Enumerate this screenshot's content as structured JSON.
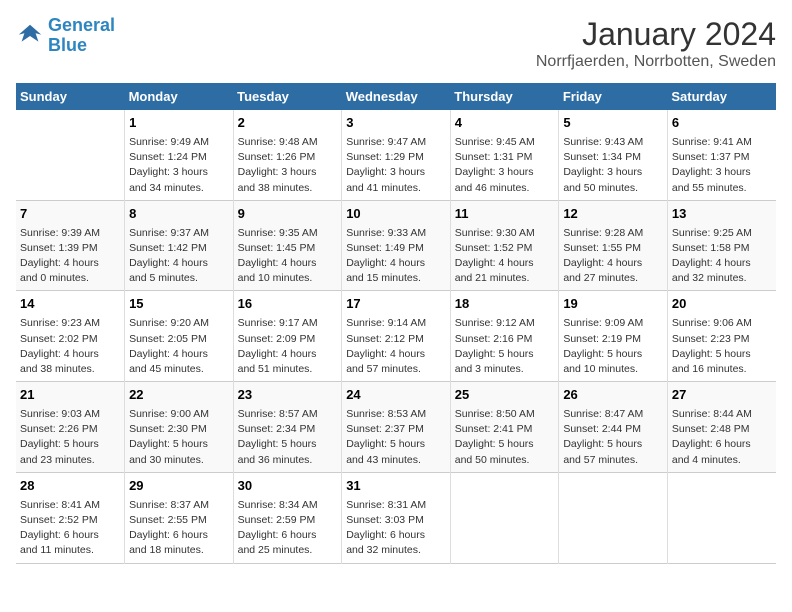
{
  "header": {
    "logo_general": "General",
    "logo_blue": "Blue",
    "title": "January 2024",
    "subtitle": "Norrfjaerden, Norrbotten, Sweden"
  },
  "weekdays": [
    "Sunday",
    "Monday",
    "Tuesday",
    "Wednesday",
    "Thursday",
    "Friday",
    "Saturday"
  ],
  "weeks": [
    [
      {
        "day": "",
        "info": ""
      },
      {
        "day": "1",
        "info": "Sunrise: 9:49 AM\nSunset: 1:24 PM\nDaylight: 3 hours\nand 34 minutes."
      },
      {
        "day": "2",
        "info": "Sunrise: 9:48 AM\nSunset: 1:26 PM\nDaylight: 3 hours\nand 38 minutes."
      },
      {
        "day": "3",
        "info": "Sunrise: 9:47 AM\nSunset: 1:29 PM\nDaylight: 3 hours\nand 41 minutes."
      },
      {
        "day": "4",
        "info": "Sunrise: 9:45 AM\nSunset: 1:31 PM\nDaylight: 3 hours\nand 46 minutes."
      },
      {
        "day": "5",
        "info": "Sunrise: 9:43 AM\nSunset: 1:34 PM\nDaylight: 3 hours\nand 50 minutes."
      },
      {
        "day": "6",
        "info": "Sunrise: 9:41 AM\nSunset: 1:37 PM\nDaylight: 3 hours\nand 55 minutes."
      }
    ],
    [
      {
        "day": "7",
        "info": "Sunrise: 9:39 AM\nSunset: 1:39 PM\nDaylight: 4 hours\nand 0 minutes."
      },
      {
        "day": "8",
        "info": "Sunrise: 9:37 AM\nSunset: 1:42 PM\nDaylight: 4 hours\nand 5 minutes."
      },
      {
        "day": "9",
        "info": "Sunrise: 9:35 AM\nSunset: 1:45 PM\nDaylight: 4 hours\nand 10 minutes."
      },
      {
        "day": "10",
        "info": "Sunrise: 9:33 AM\nSunset: 1:49 PM\nDaylight: 4 hours\nand 15 minutes."
      },
      {
        "day": "11",
        "info": "Sunrise: 9:30 AM\nSunset: 1:52 PM\nDaylight: 4 hours\nand 21 minutes."
      },
      {
        "day": "12",
        "info": "Sunrise: 9:28 AM\nSunset: 1:55 PM\nDaylight: 4 hours\nand 27 minutes."
      },
      {
        "day": "13",
        "info": "Sunrise: 9:25 AM\nSunset: 1:58 PM\nDaylight: 4 hours\nand 32 minutes."
      }
    ],
    [
      {
        "day": "14",
        "info": "Sunrise: 9:23 AM\nSunset: 2:02 PM\nDaylight: 4 hours\nand 38 minutes."
      },
      {
        "day": "15",
        "info": "Sunrise: 9:20 AM\nSunset: 2:05 PM\nDaylight: 4 hours\nand 45 minutes."
      },
      {
        "day": "16",
        "info": "Sunrise: 9:17 AM\nSunset: 2:09 PM\nDaylight: 4 hours\nand 51 minutes."
      },
      {
        "day": "17",
        "info": "Sunrise: 9:14 AM\nSunset: 2:12 PM\nDaylight: 4 hours\nand 57 minutes."
      },
      {
        "day": "18",
        "info": "Sunrise: 9:12 AM\nSunset: 2:16 PM\nDaylight: 5 hours\nand 3 minutes."
      },
      {
        "day": "19",
        "info": "Sunrise: 9:09 AM\nSunset: 2:19 PM\nDaylight: 5 hours\nand 10 minutes."
      },
      {
        "day": "20",
        "info": "Sunrise: 9:06 AM\nSunset: 2:23 PM\nDaylight: 5 hours\nand 16 minutes."
      }
    ],
    [
      {
        "day": "21",
        "info": "Sunrise: 9:03 AM\nSunset: 2:26 PM\nDaylight: 5 hours\nand 23 minutes."
      },
      {
        "day": "22",
        "info": "Sunrise: 9:00 AM\nSunset: 2:30 PM\nDaylight: 5 hours\nand 30 minutes."
      },
      {
        "day": "23",
        "info": "Sunrise: 8:57 AM\nSunset: 2:34 PM\nDaylight: 5 hours\nand 36 minutes."
      },
      {
        "day": "24",
        "info": "Sunrise: 8:53 AM\nSunset: 2:37 PM\nDaylight: 5 hours\nand 43 minutes."
      },
      {
        "day": "25",
        "info": "Sunrise: 8:50 AM\nSunset: 2:41 PM\nDaylight: 5 hours\nand 50 minutes."
      },
      {
        "day": "26",
        "info": "Sunrise: 8:47 AM\nSunset: 2:44 PM\nDaylight: 5 hours\nand 57 minutes."
      },
      {
        "day": "27",
        "info": "Sunrise: 8:44 AM\nSunset: 2:48 PM\nDaylight: 6 hours\nand 4 minutes."
      }
    ],
    [
      {
        "day": "28",
        "info": "Sunrise: 8:41 AM\nSunset: 2:52 PM\nDaylight: 6 hours\nand 11 minutes."
      },
      {
        "day": "29",
        "info": "Sunrise: 8:37 AM\nSunset: 2:55 PM\nDaylight: 6 hours\nand 18 minutes."
      },
      {
        "day": "30",
        "info": "Sunrise: 8:34 AM\nSunset: 2:59 PM\nDaylight: 6 hours\nand 25 minutes."
      },
      {
        "day": "31",
        "info": "Sunrise: 8:31 AM\nSunset: 3:03 PM\nDaylight: 6 hours\nand 32 minutes."
      },
      {
        "day": "",
        "info": ""
      },
      {
        "day": "",
        "info": ""
      },
      {
        "day": "",
        "info": ""
      }
    ]
  ]
}
